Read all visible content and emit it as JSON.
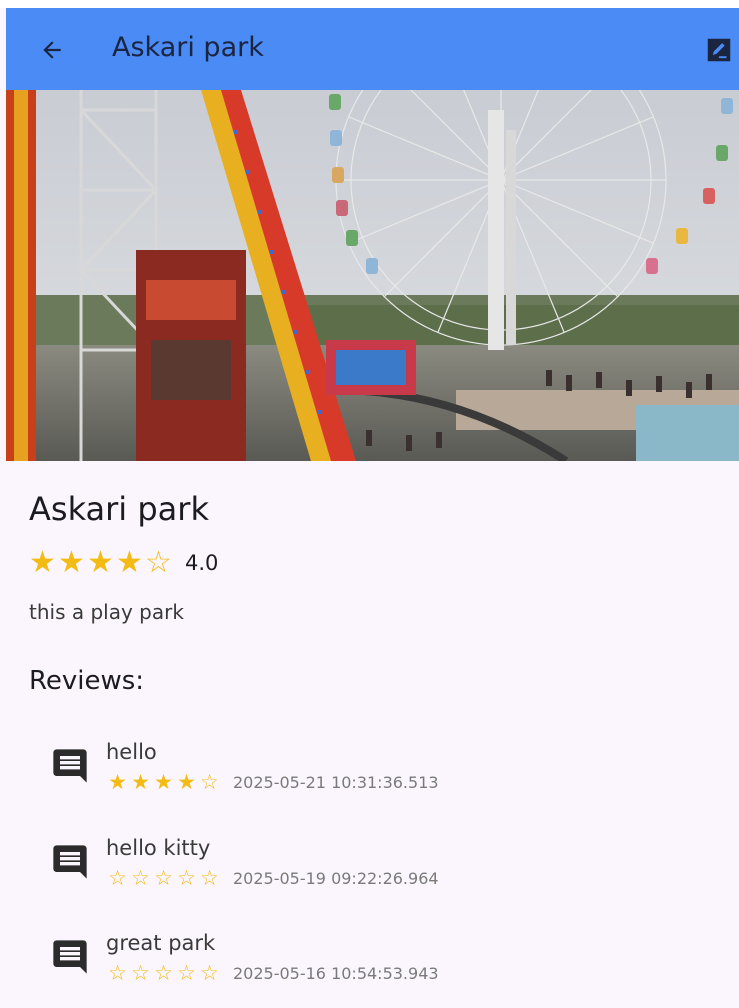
{
  "app_bar": {
    "title": "Askari park",
    "back_icon": "arrow-back-icon",
    "action_icon": "edit-note-icon",
    "color": "#4a8bf5"
  },
  "place": {
    "name": "Askari park",
    "rating": 4.0,
    "rating_label": "4.0",
    "description": "this a play park",
    "image_alt": "Amusement park with ferris wheel and roller coaster"
  },
  "reviews": {
    "heading": "Reviews:",
    "items": [
      {
        "text": "hello",
        "rating": 4,
        "date": "2025-05-21 10:31:36.513",
        "icon": "comment-icon"
      },
      {
        "text": "hello kitty",
        "rating": 0,
        "date": "2025-05-19 09:22:26.964",
        "icon": "comment-icon"
      },
      {
        "text": "great park",
        "rating": 0,
        "date": "2025-05-16 10:54:53.943",
        "icon": "comment-icon"
      }
    ]
  },
  "colors": {
    "star": "#f4bb15",
    "background": "#fbf6fd"
  }
}
